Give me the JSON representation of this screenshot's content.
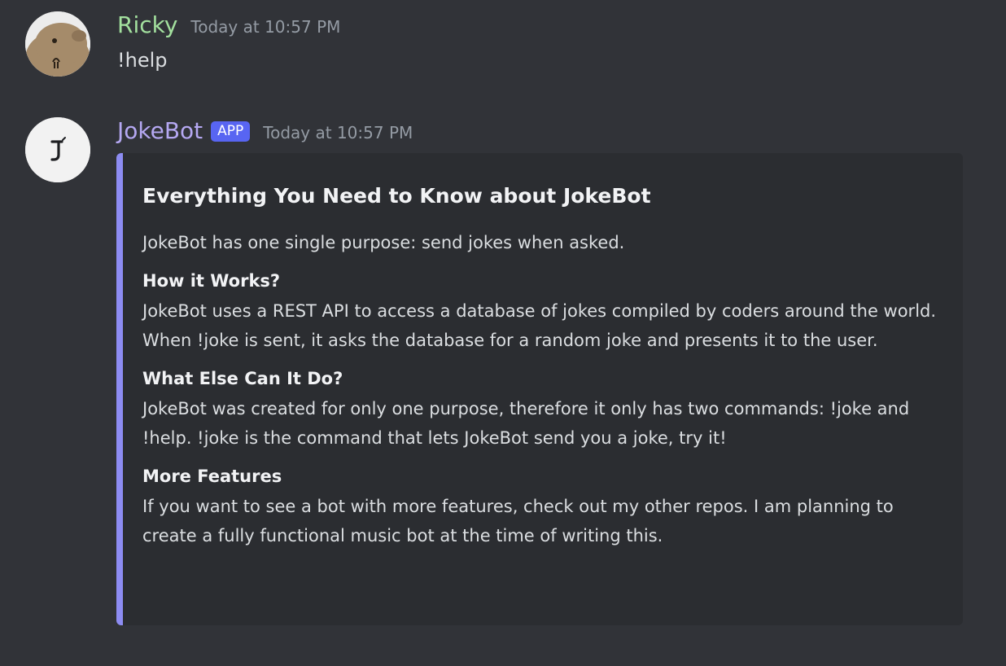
{
  "messages": [
    {
      "username": "Ricky",
      "username_color": "#a3e09e",
      "timestamp": "Today at 10:57 PM",
      "content": "!help",
      "avatar_icon": "capybara-avatar-icon"
    },
    {
      "username": "JokeBot",
      "username_color": "#b5a8f2",
      "badge": "APP",
      "timestamp": "Today at 10:57 PM",
      "avatar_icon": "jokebot-logo-icon",
      "embed": {
        "accent_color": "#8d8cf2",
        "title": "Everything You Need to Know about JokeBot",
        "description": "JokeBot has one single purpose: send jokes when asked.",
        "fields": [
          {
            "name": "How it Works?",
            "value": "JokeBot uses a REST API to access a database of jokes compiled by coders around the world. When !joke is sent, it asks the database for a random joke and presents it to the user."
          },
          {
            "name": "What Else Can It Do?",
            "value": "JokeBot was created for only one purpose, therefore it only has two commands: !joke and !help. !joke is the command that lets JokeBot send you a joke, try it!"
          },
          {
            "name": "More Features",
            "value": "If you want to see a bot with more features, check out my other repos. I am planning to create a fully functional music bot at the time of writing this."
          }
        ]
      }
    }
  ]
}
